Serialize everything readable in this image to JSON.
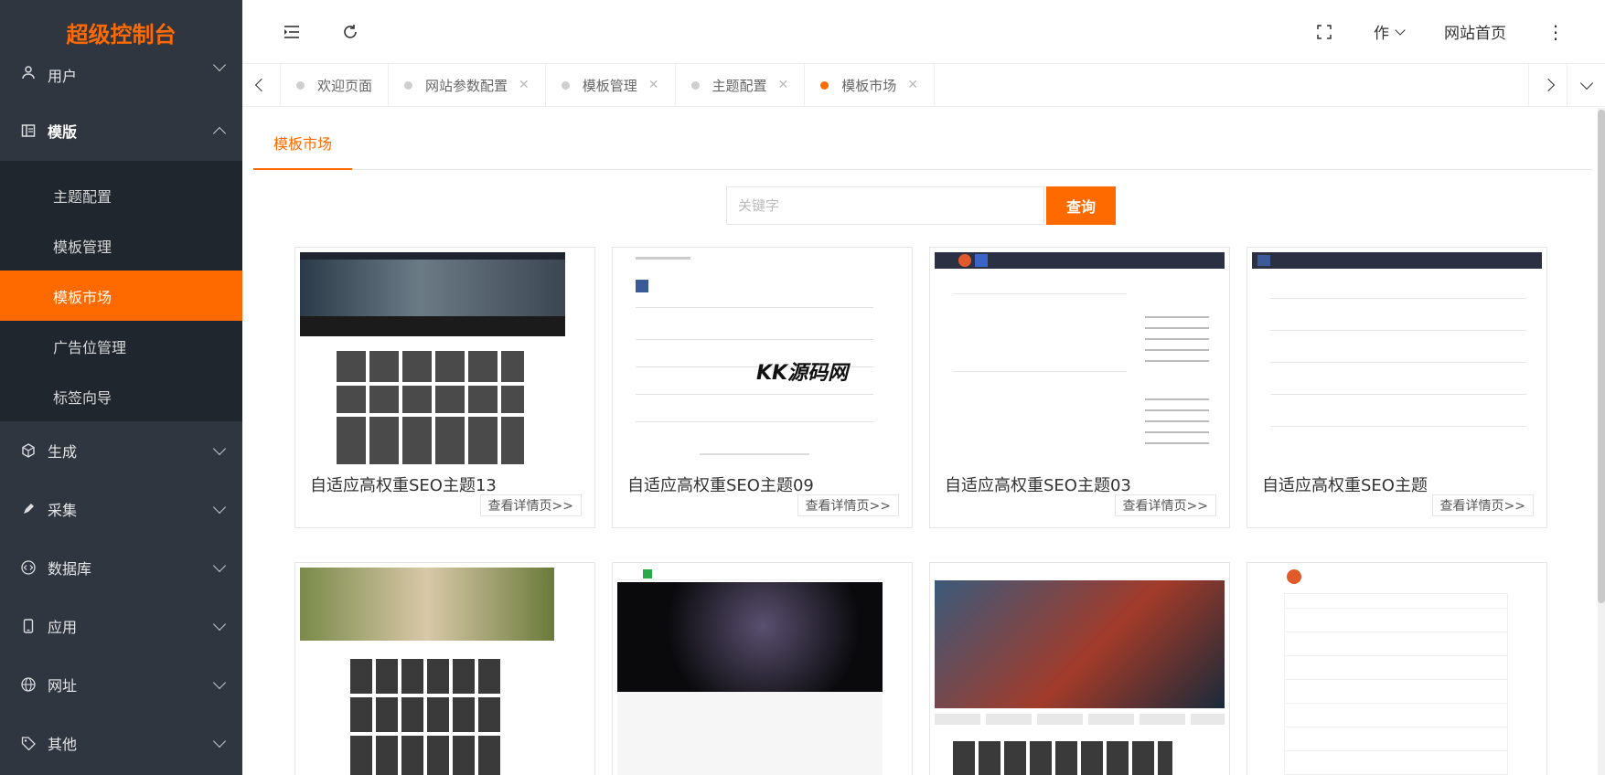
{
  "brand": "超级控制台",
  "sidebar": {
    "items": [
      {
        "label": "用户",
        "icon": "user-icon"
      },
      {
        "label": "模版",
        "icon": "template-icon",
        "expanded": true,
        "children": [
          {
            "label": "主题配置"
          },
          {
            "label": "模板管理"
          },
          {
            "label": "模板市场",
            "active": true
          },
          {
            "label": "广告位管理"
          },
          {
            "label": "标签向导"
          }
        ]
      },
      {
        "label": "生成",
        "icon": "cube-icon"
      },
      {
        "label": "采集",
        "icon": "pen-icon"
      },
      {
        "label": "数据库",
        "icon": "code-icon"
      },
      {
        "label": "应用",
        "icon": "mobile-icon"
      },
      {
        "label": "网址",
        "icon": "globe-icon"
      },
      {
        "label": "其他",
        "icon": "tag-icon"
      }
    ]
  },
  "header": {
    "user_label": "作",
    "home_label": "网站首页"
  },
  "tabs": [
    {
      "label": "欢迎页面",
      "closable": false
    },
    {
      "label": "网站参数配置",
      "closable": true
    },
    {
      "label": "模板管理",
      "closable": true
    },
    {
      "label": "主题配置",
      "closable": true
    },
    {
      "label": "模板市场",
      "closable": true,
      "active": true
    }
  ],
  "content": {
    "subtab": "模板市场",
    "search_placeholder": "关键字",
    "search_button": "查询",
    "detail_label": "查看详情页>>",
    "watermark": "KK源码网",
    "cards": [
      {
        "title": "自适应高权重SEO主题13"
      },
      {
        "title": "自适应高权重SEO主题09"
      },
      {
        "title": "自适应高权重SEO主题03"
      },
      {
        "title": "自适应高权重SEO主题"
      }
    ]
  },
  "colors": {
    "accent": "#ff6a00",
    "sidebar_bg": "#2f3640",
    "submenu_bg": "#20262d"
  }
}
